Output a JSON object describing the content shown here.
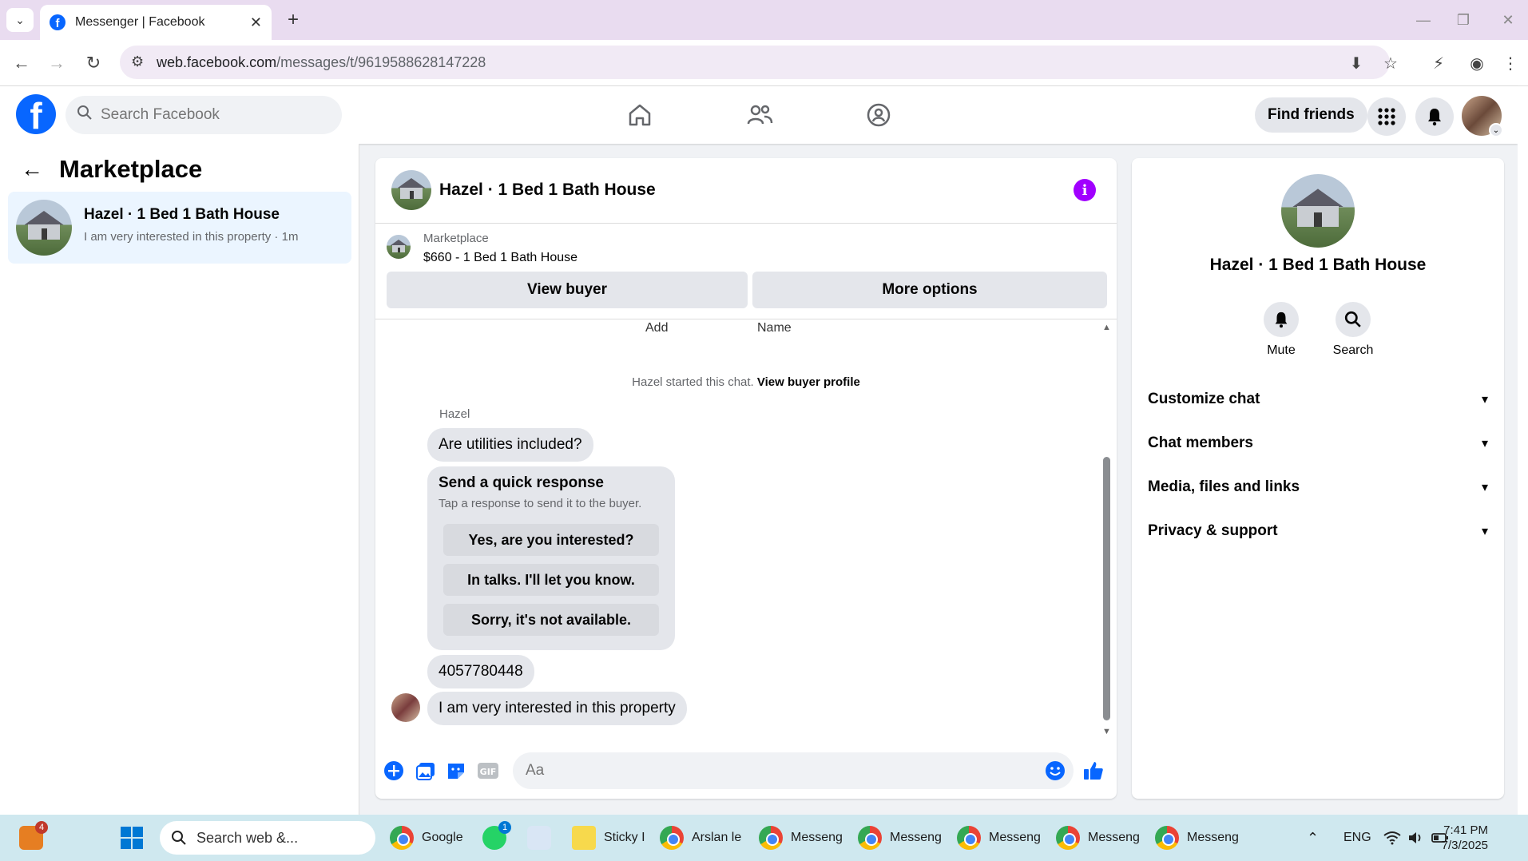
{
  "browser": {
    "tab_title": "Messenger | Facebook",
    "url_domain": "web.facebook.com",
    "url_path": "/messages/t/9619588628147228"
  },
  "header": {
    "search_placeholder": "Search Facebook",
    "find_friends": "Find friends"
  },
  "sidebar": {
    "title": "Marketplace",
    "conversations": [
      {
        "name": "Hazel · 1 Bed 1 Bath House",
        "snippet": "I am very interested in this property · 1m"
      }
    ]
  },
  "chat": {
    "title": "Hazel · 1 Bed 1 Bath House",
    "marketplace_label": "Marketplace",
    "listing": "$660 - 1 Bed 1 Bath House",
    "view_buyer": "View buyer",
    "more_options": "More options",
    "partial_add": "Add",
    "partial_name": "Name",
    "started_prefix": "Hazel started this chat.",
    "started_link": "View buyer profile",
    "sender": "Hazel",
    "messages": [
      "Are utilities included?",
      "4057780448",
      "I am very interested in this property"
    ],
    "quick_response": {
      "title": "Send a quick response",
      "subtitle": "Tap a response to send it to the buyer.",
      "options": [
        "Yes, are you interested?",
        "In talks. I'll let you know.",
        "Sorry, it's not available."
      ]
    },
    "composer_placeholder": "Aa"
  },
  "details": {
    "name": "Hazel · 1 Bed 1 Bath House",
    "mute": "Mute",
    "search": "Search",
    "sections": [
      "Customize chat",
      "Chat members",
      "Media, files and links",
      "Privacy & support"
    ]
  },
  "taskbar": {
    "weather_badge": "4",
    "search_placeholder": "Search web &...",
    "whatsapp_badge": "1",
    "items": [
      "Google",
      "Sticky I",
      "Arslan le",
      "Messeng",
      "Messeng",
      "Messeng",
      "Messeng",
      "Messeng"
    ],
    "language": "ENG",
    "time": "7:41 PM",
    "date": "7/3/2025"
  },
  "colors": {
    "brand_blue": "#0866ff",
    "info_purple": "#a100ff",
    "selected_conv": "#ebf5ff"
  }
}
